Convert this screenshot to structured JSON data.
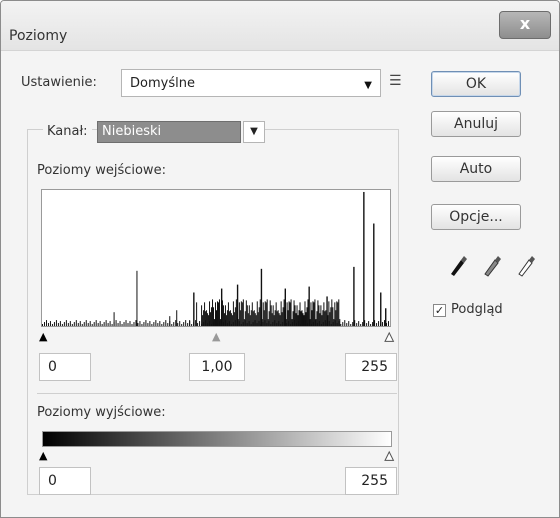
{
  "window": {
    "title": "Poziomy",
    "close_glyph": "x"
  },
  "preset": {
    "label": "Ustawienie:",
    "value": "Domyślne",
    "menu_icon": "list-menu-icon"
  },
  "channel": {
    "label": "Kanał:",
    "value": "Niebieski"
  },
  "input_levels": {
    "label": "Poziomy wejściowe:",
    "black": "0",
    "gamma": "1,00",
    "white": "255"
  },
  "output_levels": {
    "label": "Poziomy wyjściowe:",
    "black": "0",
    "white": "255"
  },
  "buttons": {
    "ok": "OK",
    "cancel": "Anuluj",
    "auto": "Auto",
    "options": "Opcje..."
  },
  "eyedroppers": [
    "black-point-eyedropper-icon",
    "gray-point-eyedropper-icon",
    "white-point-eyedropper-icon"
  ],
  "preview": {
    "label": "Podgląd",
    "checked": true
  },
  "colors": {
    "histogram_bar": "#111111",
    "channel_highlight": "#8d8d8d"
  }
}
